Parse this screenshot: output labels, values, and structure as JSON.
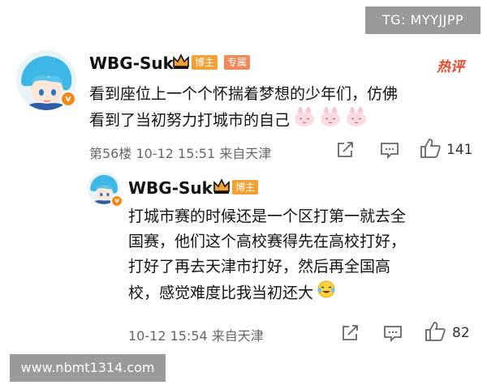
{
  "watermarks": {
    "top": "TG: MYYJJPP",
    "bottom": "www.nbmt1314.com"
  },
  "comment": {
    "username": "WBG-Suk",
    "badge_blogger": "博主",
    "badge_pro": "专属",
    "hot_label": "热评",
    "text_line1": "看到座位上一个个怀揣着梦想的少年们，仿佛",
    "text_line2": "看到了当初努力打城市的自己",
    "emoji_count": 3,
    "meta": "第56楼 10-12 15:51 来自天津",
    "likes": "141"
  },
  "reply": {
    "username": "WBG-Suk",
    "badge_blogger": "博主",
    "text_line1": "打城市赛的时候还是一个区打第一就去全",
    "text_line2": "国赛，他们这个高校赛得先在高校打好，",
    "text_line3": "打好了再去天津市打好，然后再全国高",
    "text_line4": "校，感觉难度比我当初还大",
    "meta": "10-12 15:54 来自天津",
    "likes": "82"
  },
  "colors": {
    "accent_orange": "#f28a1a",
    "hot_red": "#e54b2a",
    "avatar_hair": "#3fb7e6"
  }
}
